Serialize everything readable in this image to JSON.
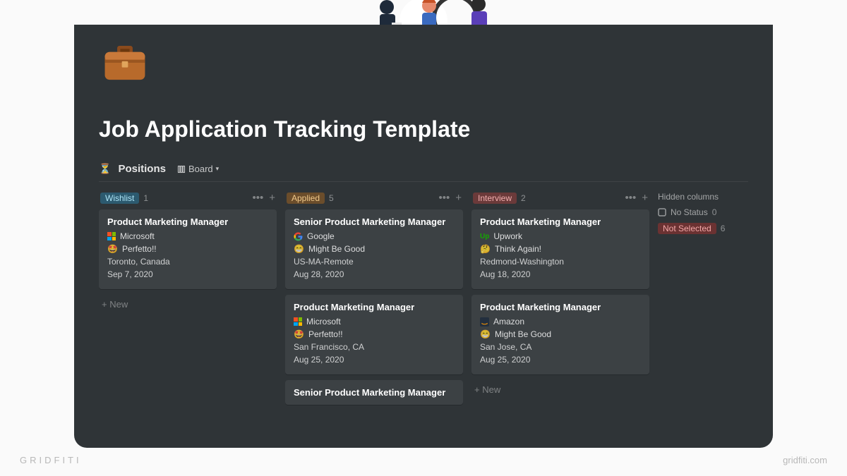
{
  "page": {
    "title": "Job Application Tracking Template",
    "icon_name": "briefcase-icon"
  },
  "view": {
    "db_icon": "⏳",
    "db_name": "Positions",
    "selector_label": "Board"
  },
  "columns": [
    {
      "id": "wishlist",
      "label": "Wishlist",
      "count": "1",
      "color_class": "c-wishlist",
      "cards": [
        {
          "title": "Product Marketing Manager",
          "company": "Microsoft",
          "company_icon": "microsoft",
          "fit_emoji": "🤩",
          "fit_label": "Perfetto!!",
          "location": "Toronto, Canada",
          "date": "Sep 7, 2020"
        }
      ]
    },
    {
      "id": "applied",
      "label": "Applied",
      "count": "5",
      "color_class": "c-applied",
      "cards": [
        {
          "title": "Senior Product Marketing Manager",
          "company": "Google",
          "company_icon": "google",
          "fit_emoji": "😁",
          "fit_label": "Might Be Good",
          "location": "US-MA-Remote",
          "date": "Aug 28, 2020"
        },
        {
          "title": "Product Marketing Manager",
          "company": "Microsoft",
          "company_icon": "microsoft",
          "fit_emoji": "🤩",
          "fit_label": "Perfetto!!",
          "location": "San Francisco, CA",
          "date": "Aug 25, 2020"
        },
        {
          "title": "Senior Product Marketing Manager",
          "company": "",
          "company_icon": "",
          "fit_emoji": "",
          "fit_label": "",
          "location": "",
          "date": ""
        }
      ]
    },
    {
      "id": "interview",
      "label": "Interview",
      "count": "2",
      "color_class": "c-interview",
      "cards": [
        {
          "title": "Product Marketing Manager",
          "company": "Upwork",
          "company_icon": "upwork",
          "fit_emoji": "🤔",
          "fit_label": "Think Again!",
          "location": "Redmond-Washington",
          "date": "Aug 18, 2020"
        },
        {
          "title": "Product Marketing Manager",
          "company": "Amazon",
          "company_icon": "amazon",
          "fit_emoji": "😁",
          "fit_label": "Might Be Good",
          "location": "San Jose, CA",
          "date": "Aug 25, 2020"
        }
      ]
    }
  ],
  "hidden": {
    "title": "Hidden columns",
    "rows": [
      {
        "icon": "⬜",
        "label": "No Status",
        "count": "0",
        "tag": false
      },
      {
        "icon": "",
        "label": "Not Selected",
        "count": "6",
        "tag": true,
        "color_class": "c-notsel"
      }
    ]
  },
  "labels": {
    "new": "New",
    "more": "•••",
    "plus": "+"
  },
  "footer": {
    "left": "GRIDFITI",
    "right": "gridfiti.com"
  }
}
